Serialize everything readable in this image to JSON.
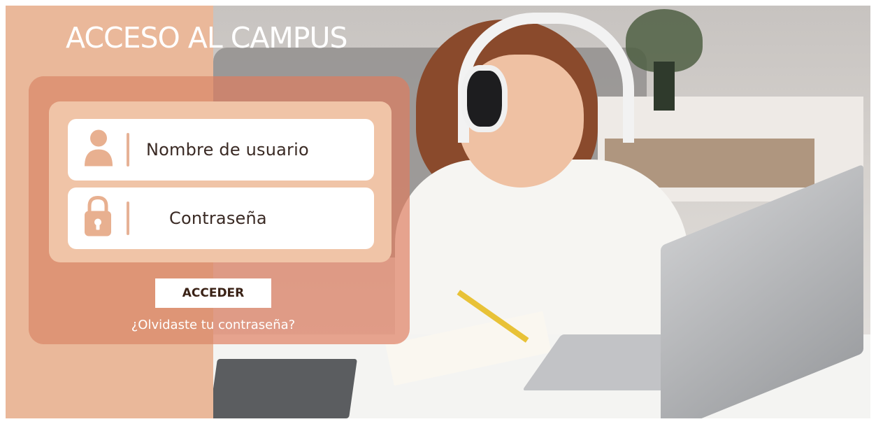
{
  "page": {
    "title": "ACCESO AL CAMPUS"
  },
  "login": {
    "username_placeholder": "Nombre de usuario",
    "password_placeholder": "Contraseña",
    "submit_label": "ACCEDER",
    "forgot_link": "¿Olvidaste tu contraseña?"
  },
  "icons": {
    "username": "user-icon",
    "password": "lock-icon"
  },
  "colors": {
    "left_panel": "#eab89a",
    "overlay": "#de7c5e",
    "inner_panel": "#f0c4a7",
    "icon": "#e8b090",
    "text_dark": "#3a2a24",
    "text_light": "#ffffff"
  }
}
